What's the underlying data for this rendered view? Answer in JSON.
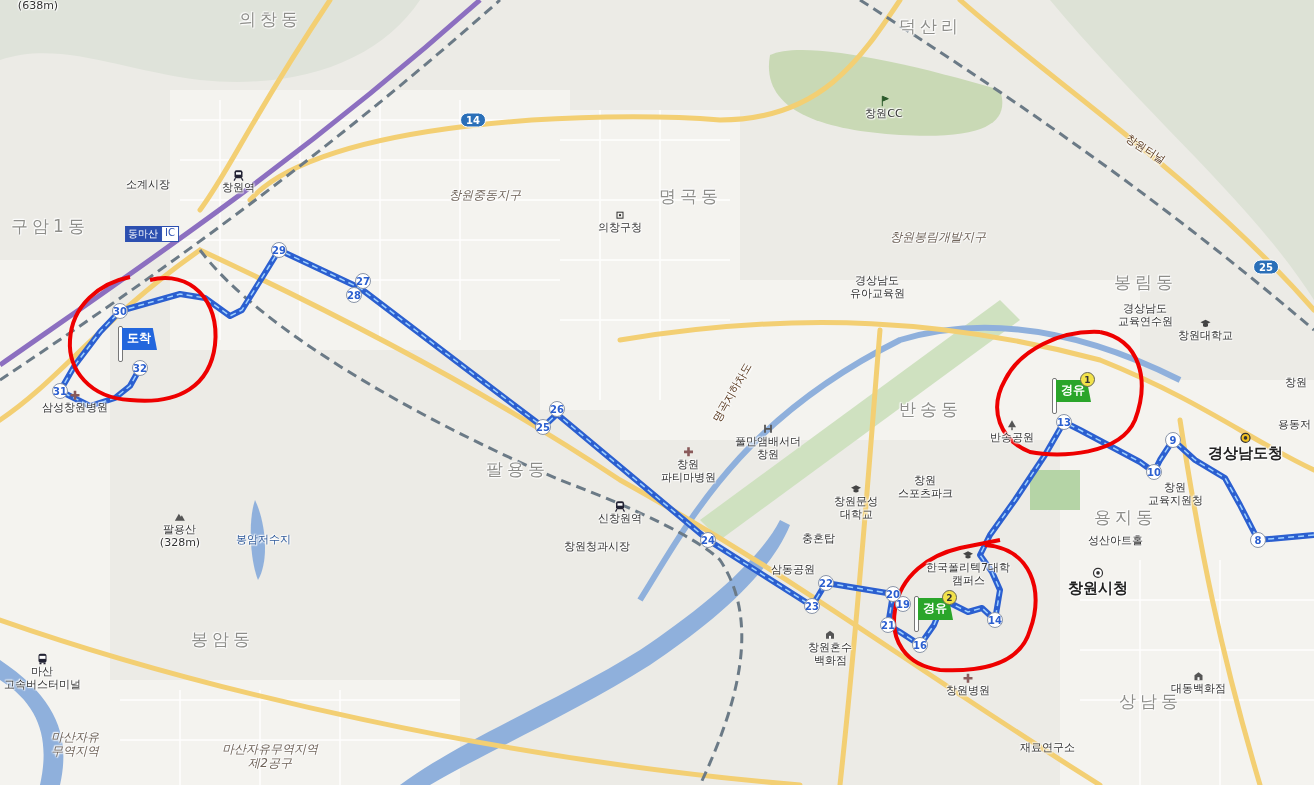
{
  "map": {
    "labels": [
      {
        "kind": "place",
        "lines": [
          "(638m)"
        ]
      },
      {
        "kind": "district",
        "lines": [
          "의창동"
        ]
      },
      {
        "kind": "district",
        "lines": [
          "덕산리"
        ]
      },
      {
        "kind": "place",
        "lines": [
          "창원CC"
        ]
      },
      {
        "kind": "road",
        "lines": [
          "창원터널"
        ]
      },
      {
        "kind": "place",
        "lines": [
          "소계시장"
        ]
      },
      {
        "kind": "place",
        "lines": [
          "창원역"
        ]
      },
      {
        "kind": "zone",
        "lines": [
          "창원중동지구"
        ]
      },
      {
        "kind": "district",
        "lines": [
          "명곡동"
        ]
      },
      {
        "kind": "place",
        "lines": [
          "의창구청"
        ]
      },
      {
        "kind": "district",
        "lines": [
          "구암1동"
        ]
      },
      {
        "kind": "zone",
        "lines": [
          "창원봉림개발지구"
        ]
      },
      {
        "kind": "place",
        "lines": [
          "경상남도",
          "유아교육원"
        ]
      },
      {
        "kind": "district",
        "lines": [
          "봉림동"
        ]
      },
      {
        "kind": "place",
        "lines": [
          "경상남도",
          "교육연수원"
        ]
      },
      {
        "kind": "place",
        "lines": [
          "창원대학교"
        ]
      },
      {
        "kind": "place",
        "lines": [
          "창원"
        ]
      },
      {
        "kind": "place",
        "lines": [
          "삼성창원병원"
        ]
      },
      {
        "kind": "road",
        "lines": [
          "명곡지하차도"
        ]
      },
      {
        "kind": "district",
        "lines": [
          "반송동"
        ]
      },
      {
        "kind": "place",
        "lines": [
          "용동저"
        ]
      },
      {
        "kind": "place",
        "lines": [
          "풀만앰배서더",
          "창원"
        ]
      },
      {
        "kind": "place",
        "lines": [
          "반송공원"
        ]
      },
      {
        "kind": "major",
        "lines": [
          "경상남도청"
        ]
      },
      {
        "kind": "district",
        "lines": [
          "팔용동"
        ]
      },
      {
        "kind": "place",
        "lines": [
          "창원",
          "파티마병원"
        ]
      },
      {
        "kind": "place",
        "lines": [
          "창원문성",
          "대학교"
        ]
      },
      {
        "kind": "place",
        "lines": [
          "창원",
          "스포츠파크"
        ]
      },
      {
        "kind": "place",
        "lines": [
          "창원",
          "교육지원청"
        ]
      },
      {
        "kind": "place",
        "lines": [
          "팔용산",
          "(328m)"
        ]
      },
      {
        "kind": "water",
        "lines": [
          "봉암저수지"
        ]
      },
      {
        "kind": "place",
        "lines": [
          "신창원역"
        ]
      },
      {
        "kind": "place",
        "lines": [
          "창원청과시장"
        ]
      },
      {
        "kind": "place",
        "lines": [
          "충혼탑"
        ]
      },
      {
        "kind": "district",
        "lines": [
          "용지동"
        ]
      },
      {
        "kind": "place",
        "lines": [
          "성산아트홀"
        ]
      },
      {
        "kind": "place",
        "lines": [
          "삼동공원"
        ]
      },
      {
        "kind": "place",
        "lines": [
          "한국폴리텍7대학",
          "캠퍼스"
        ]
      },
      {
        "kind": "major",
        "lines": [
          "창원시청"
        ]
      },
      {
        "kind": "district",
        "lines": [
          "봉암동"
        ]
      },
      {
        "kind": "place",
        "lines": [
          "창원혼수",
          "백화점"
        ]
      },
      {
        "kind": "place",
        "lines": [
          "마산",
          "고속버스터미널"
        ]
      },
      {
        "kind": "place",
        "lines": [
          "창원병원"
        ]
      },
      {
        "kind": "place",
        "lines": [
          "대동백화점"
        ]
      },
      {
        "kind": "district",
        "lines": [
          "상남동"
        ]
      },
      {
        "kind": "zone",
        "lines": [
          "마산자유",
          "무역지역"
        ]
      },
      {
        "kind": "zone",
        "lines": [
          "마산자유무역지역",
          "제2공구"
        ]
      },
      {
        "kind": "place",
        "lines": [
          "재료연구소"
        ]
      }
    ],
    "road_badges": [
      "14",
      "25"
    ],
    "interchange": {
      "name": "동마산",
      "tag": "IC"
    },
    "route_markers": [
      "8",
      "9",
      "10",
      "13",
      "14",
      "16",
      "19",
      "20",
      "21",
      "22",
      "23",
      "24",
      "25",
      "26",
      "27",
      "28",
      "29",
      "30",
      "31",
      "32"
    ],
    "waypoints": [
      {
        "kind": "via",
        "label": "경유",
        "number": "1"
      },
      {
        "kind": "via",
        "label": "경유",
        "number": "2"
      },
      {
        "kind": "arrival",
        "label": "도착"
      }
    ]
  }
}
